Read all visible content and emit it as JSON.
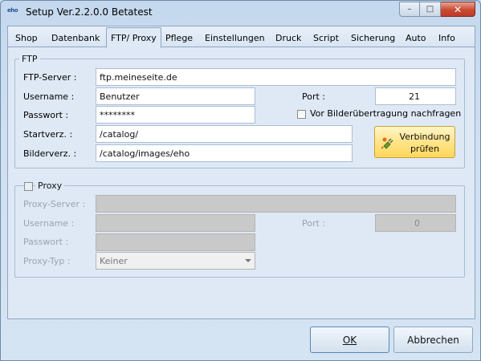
{
  "window": {
    "title": "Setup Ver.2.2.0.0 Betatest",
    "app_icon_text": "eho",
    "controls": {
      "minimize": "–",
      "maximize": "□",
      "close": "✕"
    }
  },
  "tabs": [
    {
      "label": "Shop",
      "active": false
    },
    {
      "label": "Datenbank",
      "active": false
    },
    {
      "label": "FTP/ Proxy",
      "active": true
    },
    {
      "label": "Pflege",
      "active": false
    },
    {
      "label": "Einstellungen",
      "active": false
    },
    {
      "label": "Druck",
      "active": false
    },
    {
      "label": "Script",
      "active": false
    },
    {
      "label": "Sicherung",
      "active": false
    },
    {
      "label": "Auto",
      "active": false
    },
    {
      "label": "Info",
      "active": false
    }
  ],
  "ftp": {
    "group_title": "FTP",
    "server_label": "FTP-Server :",
    "server_value": "ftp.meineseite.de",
    "username_label": "Username :",
    "username_value": "Benutzer",
    "password_label": "Passwort :",
    "password_value": "********",
    "port_label": "Port :",
    "port_value": "21",
    "ask_before_upload_label": "Vor Bilderübertragung nachfragen",
    "ask_before_upload_checked": false,
    "startdir_label": "Startverz. :",
    "startdir_value": "/catalog/",
    "imagedir_label": "Bilderverz. :",
    "imagedir_value": "/catalog/images/eho",
    "test_button_line1": "Verbindung",
    "test_button_line2": "prüfen",
    "test_button_icon": "plug-icon"
  },
  "proxy": {
    "group_title": "Proxy",
    "enabled": false,
    "server_label": "Proxy-Server :",
    "server_value": "",
    "username_label": "Username :",
    "username_value": "",
    "password_label": "Passwort :",
    "password_value": "",
    "port_label": "Port :",
    "port_value": "0",
    "type_label": "Proxy-Typ :",
    "type_value": "Keiner"
  },
  "footer": {
    "ok_label": "OK",
    "cancel_label": "Abbrechen"
  },
  "colors": {
    "accent": "#5b86b7",
    "test_button": "#ffe48a",
    "close_button": "#c94a31"
  }
}
